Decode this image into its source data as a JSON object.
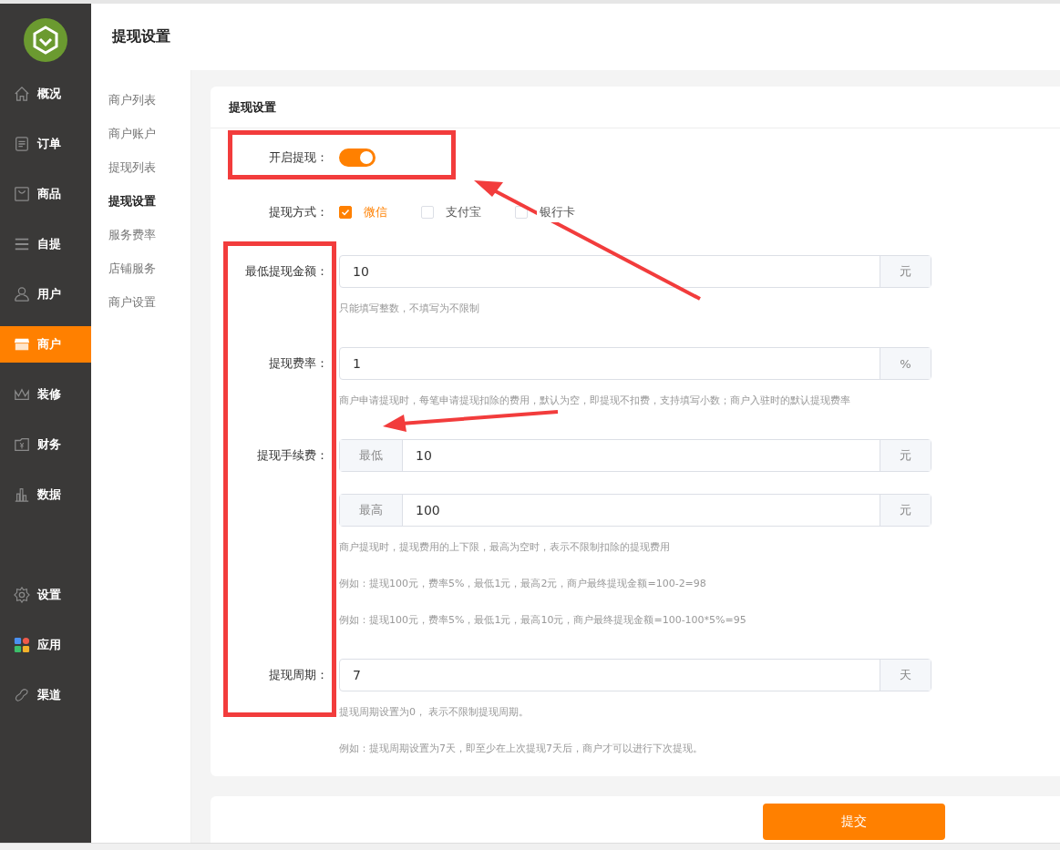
{
  "sidebar": {
    "items": [
      {
        "label": "概况",
        "kind": "home",
        "selected": false
      },
      {
        "label": "订单",
        "kind": "doc",
        "selected": false
      },
      {
        "label": "商品",
        "kind": "bag",
        "selected": false
      },
      {
        "label": "自提",
        "kind": "lines",
        "selected": false
      },
      {
        "label": "用户",
        "kind": "user",
        "selected": false
      },
      {
        "label": "商户",
        "kind": "store",
        "selected": true
      },
      {
        "label": "装修",
        "kind": "crown",
        "selected": false
      },
      {
        "label": "财务",
        "kind": "wallet",
        "selected": false
      },
      {
        "label": "数据",
        "kind": "chart",
        "selected": false
      },
      {
        "label": "设置",
        "kind": "gear",
        "selected": false
      },
      {
        "label": "应用",
        "kind": "apps",
        "selected": false
      },
      {
        "label": "渠道",
        "kind": "link",
        "selected": false
      }
    ]
  },
  "page_title": "提现设置",
  "subnav": {
    "items": [
      {
        "label": "商户列表",
        "selected": false
      },
      {
        "label": "商户账户",
        "selected": false
      },
      {
        "label": "提现列表",
        "selected": false
      },
      {
        "label": "提现设置",
        "selected": true
      },
      {
        "label": "服务费率",
        "selected": false
      },
      {
        "label": "店铺服务",
        "selected": false
      },
      {
        "label": "商户设置",
        "selected": false
      }
    ]
  },
  "card": {
    "title": "提现设置",
    "fields": [
      {
        "kind": "switch",
        "label": "开启提现：",
        "on": true
      },
      {
        "kind": "checks",
        "label": "提现方式：",
        "options": [
          {
            "label": "微信",
            "checked": true
          },
          {
            "label": "支付宝",
            "checked": false
          },
          {
            "label": "银行卡",
            "checked": false
          }
        ]
      },
      {
        "kind": "input",
        "label": "最低提现金额：",
        "inputs": [
          {
            "value": "10",
            "suffix": "元"
          }
        ],
        "hints": [
          "只能填写整数，不填写为不限制"
        ]
      },
      {
        "kind": "input",
        "label": "提现费率：",
        "inputs": [
          {
            "value": "1",
            "suffix": "%"
          }
        ],
        "hints": [
          "商户申请提现时，每笔申请提现扣除的费用，默认为空，即提现不扣费，支持填写小数；商户入驻时的默认提现费率"
        ]
      },
      {
        "kind": "input",
        "label": "提现手续费：",
        "inputs": [
          {
            "prefix": "最低",
            "value": "10",
            "suffix": "元"
          },
          {
            "prefix": "最高",
            "value": "100",
            "suffix": "元"
          }
        ],
        "hints": [
          "商户提现时，提现费用的上下限，最高为空时，表示不限制扣除的提现费用",
          "例如：提现100元，费率5%，最低1元，最高2元，商户最终提现金额=100-2=98",
          "例如：提现100元，费率5%，最低1元，最高10元，商户最终提现金额=100-100*5%=95"
        ]
      },
      {
        "kind": "input",
        "label": "提现周期：",
        "inputs": [
          {
            "value": "7",
            "suffix": "天"
          }
        ],
        "hints": [
          "提现周期设置为0， 表示不限制提现周期。",
          "例如：提现周期设置为7天，即至少在上次提现7天后，商户才可以进行下次提现。"
        ]
      }
    ]
  },
  "submit": "提交"
}
